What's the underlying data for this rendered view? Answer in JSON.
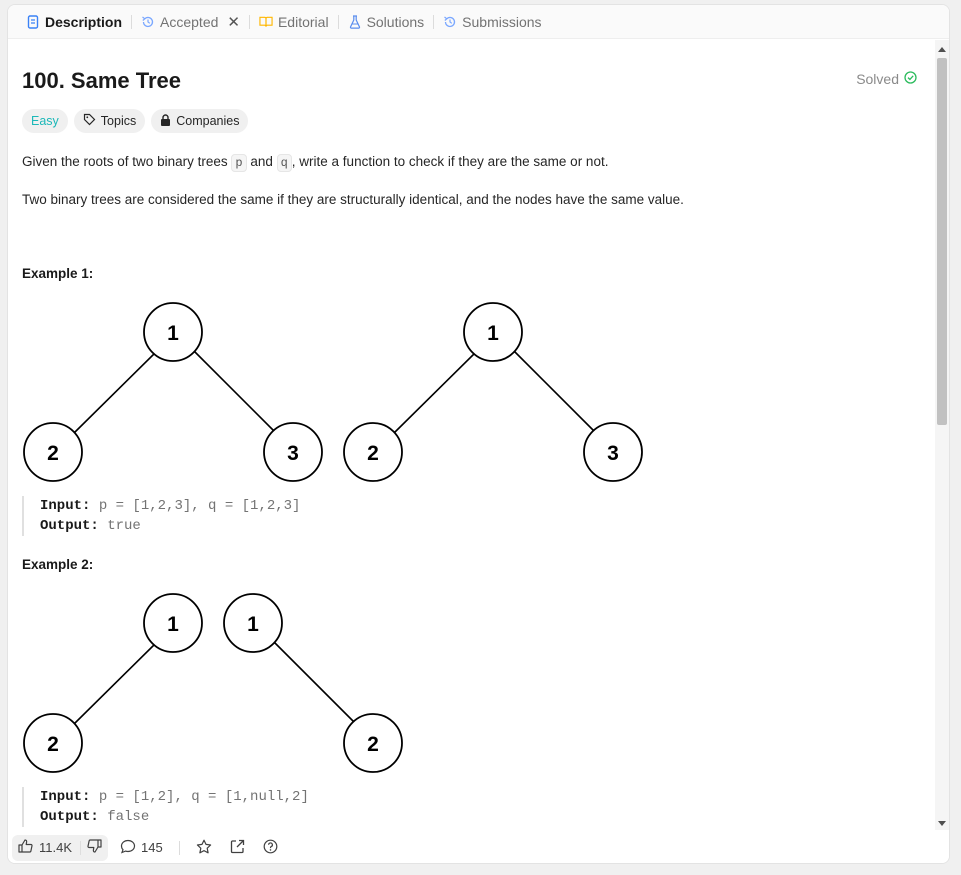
{
  "tabs": [
    {
      "label": "Description",
      "icon": "document-icon",
      "active": true
    },
    {
      "label": "Accepted",
      "icon": "history-icon",
      "closable": true
    },
    {
      "label": "Editorial",
      "icon": "book-icon"
    },
    {
      "label": "Solutions",
      "icon": "flask-icon"
    },
    {
      "label": "Submissions",
      "icon": "history-icon"
    }
  ],
  "problem": {
    "title": "100. Same Tree",
    "status": "Solved",
    "difficulty": "Easy",
    "topics_label": "Topics",
    "companies_label": "Companies",
    "desc1_pre": "Given the roots of two binary trees ",
    "desc1_p": "p",
    "desc1_and": " and ",
    "desc1_q": "q",
    "desc1_post": ", write a function to check if they are the same or not.",
    "desc2": "Two binary trees are considered the same if they are structurally identical, and the nodes have the same value."
  },
  "examples": [
    {
      "title": "Example 1:",
      "input_label": "Input:",
      "input": "p = [1,2,3], q = [1,2,3]",
      "output_label": "Output:",
      "output": "true",
      "trees": [
        {
          "nodes": [
            "1",
            "2",
            "3"
          ]
        },
        {
          "nodes": [
            "1",
            "2",
            "3"
          ]
        }
      ]
    },
    {
      "title": "Example 2:",
      "input_label": "Input:",
      "input": "p = [1,2], q = [1,null,2]",
      "output_label": "Output:",
      "output": "false",
      "trees": [
        {
          "nodes": [
            "1",
            "2"
          ]
        },
        {
          "nodes": [
            "1",
            "2"
          ]
        }
      ]
    }
  ],
  "footer": {
    "likes": "11.4K",
    "comments": "145"
  },
  "colors": {
    "easy": "#1cb8b8",
    "solved_check": "#2cbb5d",
    "accepted_icon": "#7aa7ff",
    "editorial_icon": "#ffb700",
    "solutions_icon": "#5a8dee",
    "description_icon": "#3b82f6"
  }
}
